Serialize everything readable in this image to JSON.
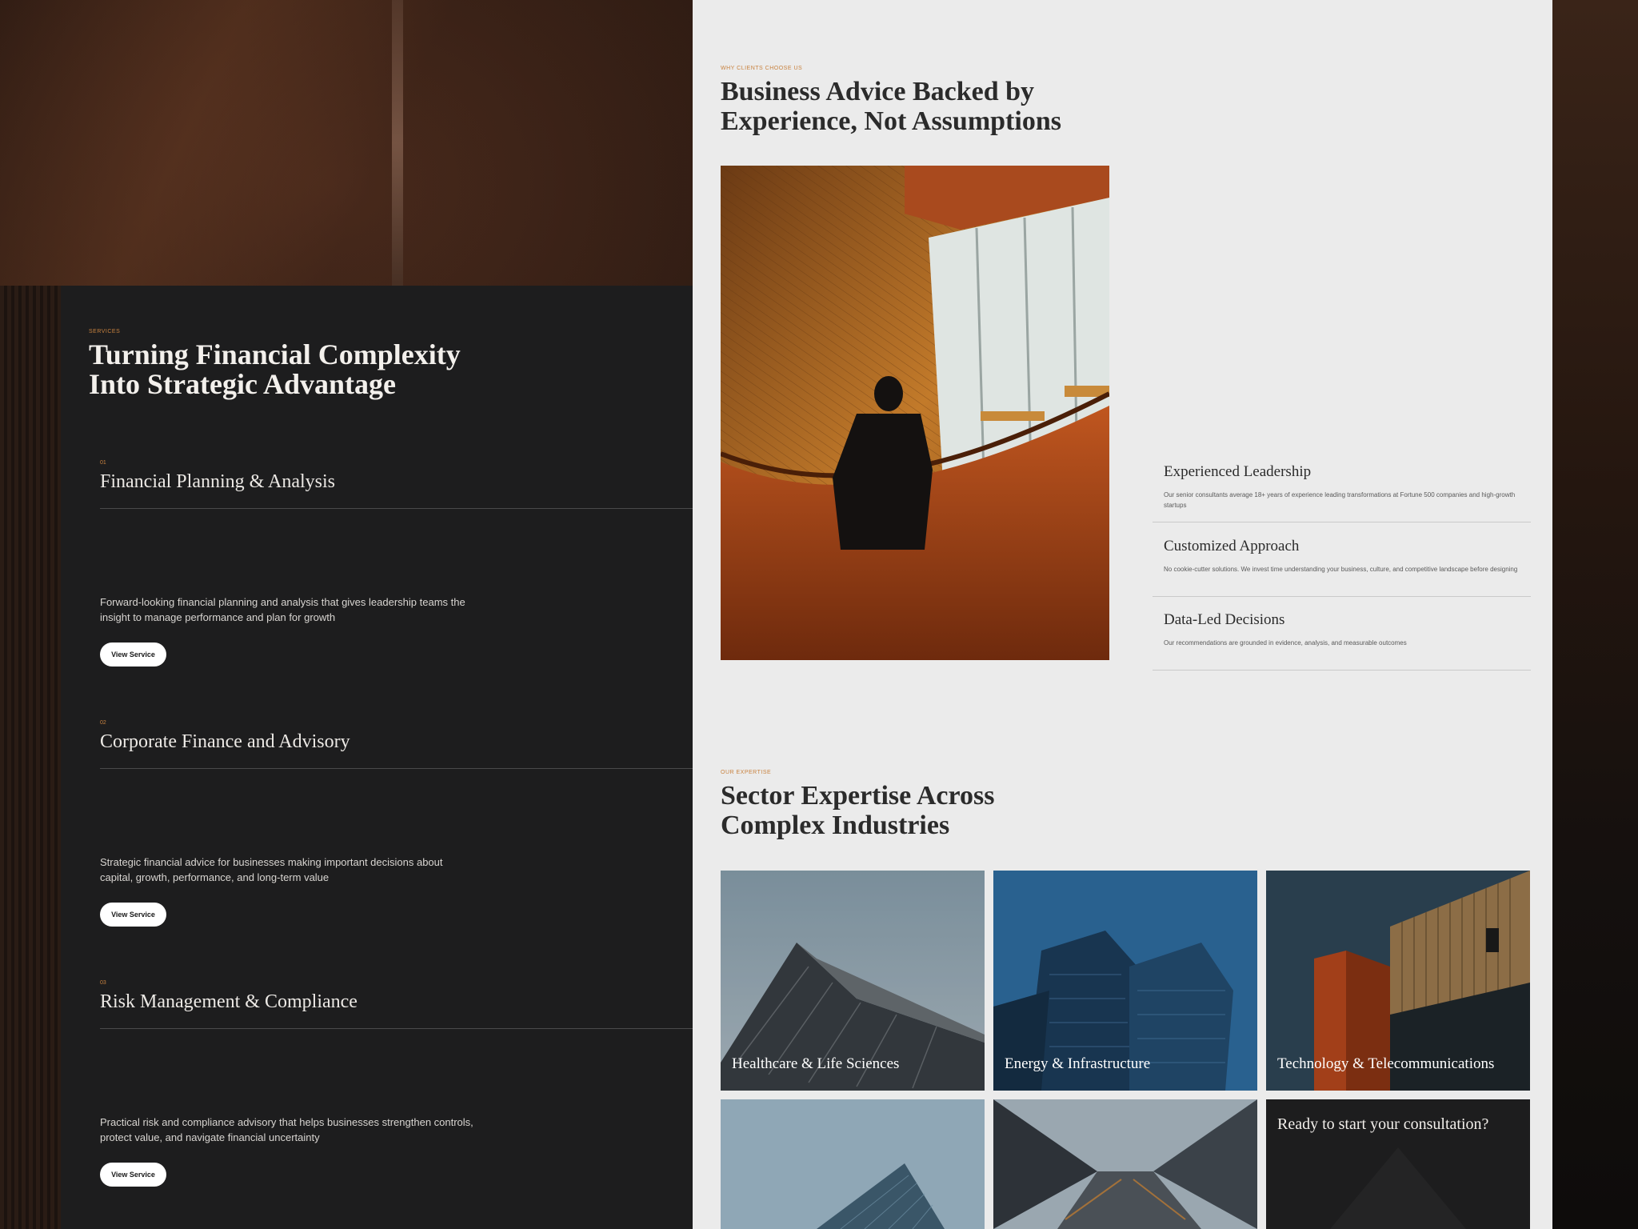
{
  "services": {
    "eyebrow": "SERVICES",
    "title": "Turning Financial Complexity Into Strategic Advantage",
    "items": [
      {
        "number": "01",
        "title": "Financial Planning & Analysis",
        "description": "Forward-looking financial planning and analysis that gives leadership teams the insight to manage performance and plan for growth",
        "button": "View Service"
      },
      {
        "number": "02",
        "title": "Corporate Finance and Advisory",
        "description": "Strategic financial advice for businesses making important decisions about capital, growth, performance, and long-term value",
        "button": "View Service"
      },
      {
        "number": "03",
        "title": "Risk Management & Compliance",
        "description": "Practical risk and compliance advisory that helps businesses strengthen controls, protect value, and navigate financial uncertainty",
        "button": "View Service"
      }
    ]
  },
  "why": {
    "eyebrow": "WHY CLIENTS CHOOSE US",
    "title": "Business Advice Backed by Experience, Not Assumptions",
    "features": [
      {
        "title": "Experienced Leadership",
        "description": "Our senior consultants average 18+ years of experience leading transformations at Fortune 500 companies and high-growth startups"
      },
      {
        "title": "Customized Approach",
        "description": "No cookie-cutter solutions. We invest time understanding your business, culture, and competitive landscape before designing"
      },
      {
        "title": "Data-Led Decisions",
        "description": "Our recommendations are grounded in evidence, analysis, and measurable outcomes"
      }
    ]
  },
  "expertise": {
    "eyebrow": "OUR EXPERTISE",
    "title": "Sector Expertise Across Complex Industries",
    "sectors": [
      "Healthcare & Life Sciences",
      "Energy & Infrastructure",
      "Technology & Telecommunications"
    ],
    "cta": "Ready to start your consultation?"
  },
  "colors": {
    "accent": "#c8823f",
    "dark_panel": "#1d1d1e",
    "light_panel": "#ebebeb"
  }
}
